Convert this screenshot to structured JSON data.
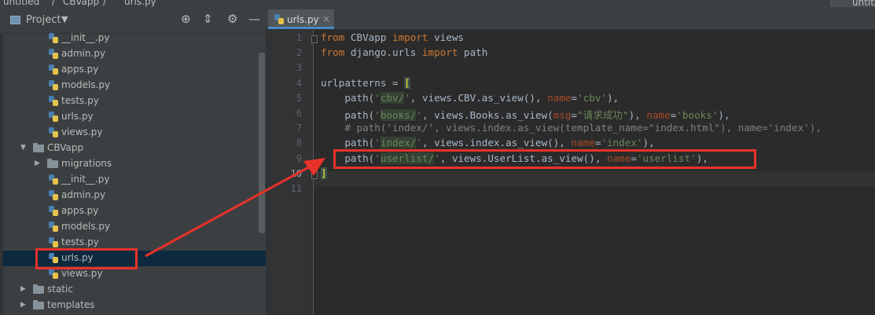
{
  "breadcrumb": [
    "untitled",
    "CBVapp",
    "urls.py"
  ],
  "top_right_tab": "untit",
  "project_panel": {
    "title": "Project",
    "icons": [
      "target-icon",
      "collapse-icon",
      "gear-icon",
      "hide-icon"
    ]
  },
  "tree": [
    {
      "type": "file",
      "label": "__init__.py",
      "level": 2
    },
    {
      "type": "file",
      "label": "admin.py",
      "level": 2
    },
    {
      "type": "file",
      "label": "apps.py",
      "level": 2
    },
    {
      "type": "file",
      "label": "models.py",
      "level": 2
    },
    {
      "type": "file",
      "label": "tests.py",
      "level": 2
    },
    {
      "type": "file",
      "label": "urls.py",
      "level": 2
    },
    {
      "type": "file",
      "label": "views.py",
      "level": 2
    },
    {
      "type": "folder",
      "label": "CBVapp",
      "level": 1,
      "expanded": true
    },
    {
      "type": "folder",
      "label": "migrations",
      "level": 2,
      "expanded": false
    },
    {
      "type": "file",
      "label": "__init__.py",
      "level": 2
    },
    {
      "type": "file",
      "label": "admin.py",
      "level": 2
    },
    {
      "type": "file",
      "label": "apps.py",
      "level": 2
    },
    {
      "type": "file",
      "label": "models.py",
      "level": 2
    },
    {
      "type": "file",
      "label": "tests.py",
      "level": 2
    },
    {
      "type": "file",
      "label": "urls.py",
      "level": 2,
      "selected": true
    },
    {
      "type": "file",
      "label": "views.py",
      "level": 2
    },
    {
      "type": "folder",
      "label": "static",
      "level": 1,
      "expanded": false
    },
    {
      "type": "folder",
      "label": "templates",
      "level": 1,
      "expanded": false
    }
  ],
  "editor": {
    "tab_label": "urls.py",
    "current_line": 10,
    "lines": [
      {
        "n": "1",
        "html": "<span class=\"kw\">from</span> CBVapp <span class=\"kw\">import</span> views"
      },
      {
        "n": "2",
        "html": "<span class=\"kw\">from</span> django.urls <span class=\"kw\">import</span> path"
      },
      {
        "n": "3",
        "html": ""
      },
      {
        "n": "4",
        "html": "urlpatterns = <span class=\"hlb\">[</span>"
      },
      {
        "n": "5",
        "html": "    path(<span class=\"str\">'<span class=\"hl\">cbv/</span>'</span>, views.CBV.as_view(), <span class=\"prm\">name</span>=<span class=\"str\">'cbv'</span>),"
      },
      {
        "n": "6",
        "html": "    path(<span class=\"str\">'<span class=\"hl\">books/</span>'</span>, views.Books.as_view(<span class=\"prm\">msg</span>=<span class=\"str\">\"请求成功\"</span>), <span class=\"prm\">name</span>=<span class=\"str\">'books'</span>),"
      },
      {
        "n": "7",
        "html": "    <span class=\"cmt\"># path('index/', views.index.as_view(template_name=\"index.html\"), name='index'),</span>"
      },
      {
        "n": "8",
        "html": "    path(<span class=\"str\">'<span class=\"hl\">index/</span>'</span>, views.index.as_view(), <span class=\"prm\">name</span>=<span class=\"str\">'index'</span>),"
      },
      {
        "n": "9",
        "html": "    path(<span class=\"str\">'<span class=\"hl\">userlist/</span>'</span>, views.UserList.as_view(), <span class=\"prm\">name</span>=<span class=\"str\">'userlist'</span>),"
      },
      {
        "n": "10",
        "html": "<span class=\"hlb\">]</span>"
      },
      {
        "n": "11",
        "html": ""
      }
    ]
  },
  "colors": {
    "annotation": "#e8322a",
    "keyword": "#cc7832",
    "string": "#6a8759",
    "param": "#aa4926",
    "comment": "#808080"
  }
}
